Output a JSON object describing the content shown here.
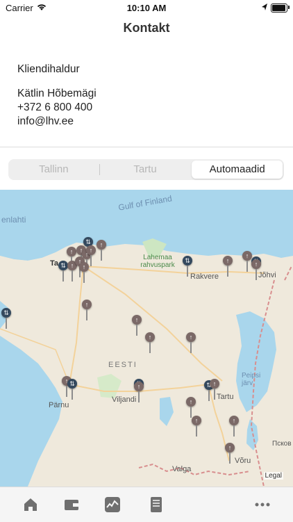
{
  "status": {
    "carrier": "Carrier",
    "time": "10:10 AM"
  },
  "nav": {
    "title": "Kontakt"
  },
  "contact": {
    "role": "Kliendihaldur",
    "name": "Kätlin Hõbemägi",
    "phone": "+372 6 800 400",
    "email": "info@lhv.ee"
  },
  "segments": [
    {
      "label": "Tallinn",
      "active": false
    },
    {
      "label": "Tartu",
      "active": false
    },
    {
      "label": "Automaadid",
      "active": true
    }
  ],
  "map": {
    "labels": {
      "gulf": "Gulf of Finland",
      "enlahti": "enlahti",
      "tallinn": "Ta",
      "lahemaa": "Lahemaa rahvuspark",
      "rakvere": "Rakvere",
      "johvi": "Jõhvi",
      "eesti": "EESTI",
      "parnu": "Pärnu",
      "viljandi": "Viljandi",
      "tartu": "Tartu",
      "peipsi": "Peipsi järv",
      "valga": "Valga",
      "voru": "Võru",
      "pskov": "Псков",
      "legal": "Legal"
    }
  },
  "tabs": [
    {
      "icon": "home-icon"
    },
    {
      "icon": "wallet-icon"
    },
    {
      "icon": "chart-icon"
    },
    {
      "icon": "document-icon"
    },
    {
      "icon": "more-icon"
    }
  ]
}
